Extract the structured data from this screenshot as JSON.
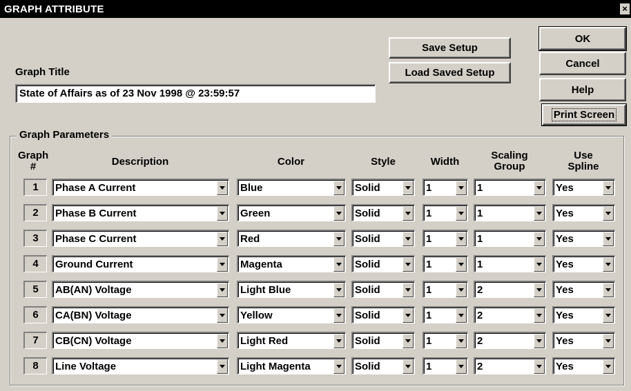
{
  "window": {
    "title": "GRAPH ATTRIBUTE",
    "close_glyph": "×"
  },
  "buttons": {
    "save_setup": "Save Setup",
    "load_saved_setup": "Load Saved Setup",
    "ok": "OK",
    "cancel": "Cancel",
    "help": "Help",
    "print_screen": "Print Screen"
  },
  "graph_title": {
    "label": "Graph Title",
    "value": "State of Affairs as of 23 Nov 1998 @ 23:59:57"
  },
  "parameters": {
    "legend": "Graph Parameters",
    "headers": {
      "graph_1": "Graph",
      "graph_2": "#",
      "description": "Description",
      "color": "Color",
      "style": "Style",
      "width": "Width",
      "scaling_1": "Scaling",
      "scaling_2": "Group",
      "spline_1": "Use",
      "spline_2": "Spline"
    },
    "rows": [
      {
        "num": "1",
        "description": "Phase A Current",
        "color": "Blue",
        "style": "Solid",
        "width": "1",
        "group": "1",
        "spline": "Yes"
      },
      {
        "num": "2",
        "description": "Phase B Current",
        "color": "Green",
        "style": "Solid",
        "width": "1",
        "group": "1",
        "spline": "Yes"
      },
      {
        "num": "3",
        "description": "Phase C Current",
        "color": "Red",
        "style": "Solid",
        "width": "1",
        "group": "1",
        "spline": "Yes"
      },
      {
        "num": "4",
        "description": "Ground Current",
        "color": "Magenta",
        "style": "Solid",
        "width": "1",
        "group": "1",
        "spline": "Yes"
      },
      {
        "num": "5",
        "description": "AB(AN) Voltage",
        "color": "Light Blue",
        "style": "Solid",
        "width": "1",
        "group": "2",
        "spline": "Yes"
      },
      {
        "num": "6",
        "description": "CA(BN) Voltage",
        "color": "Yellow",
        "style": "Solid",
        "width": "1",
        "group": "2",
        "spline": "Yes"
      },
      {
        "num": "7",
        "description": "CB(CN) Voltage",
        "color": "Light Red",
        "style": "Solid",
        "width": "1",
        "group": "2",
        "spline": "Yes"
      },
      {
        "num": "8",
        "description": "Line Voltage",
        "color": "Light Magenta",
        "style": "Solid",
        "width": "1",
        "group": "2",
        "spline": "Yes"
      }
    ]
  }
}
